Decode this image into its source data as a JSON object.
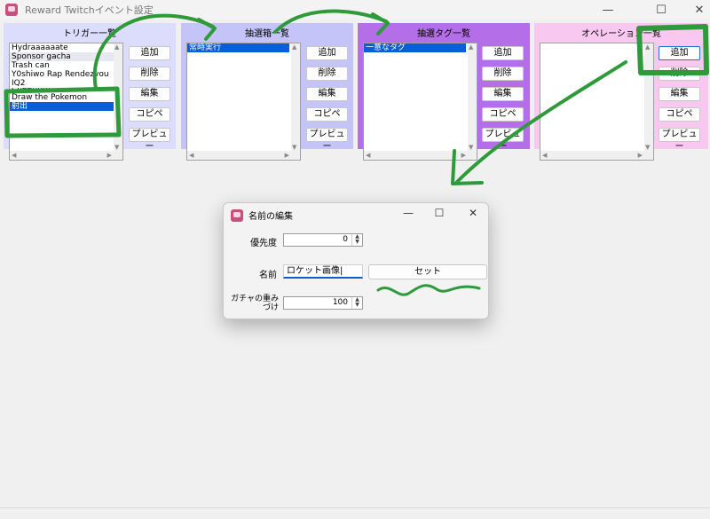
{
  "window": {
    "title": "Reward Twitchイベント設定",
    "minimize_glyph": "—",
    "maximize_glyph": "☐",
    "close_glyph": "✕"
  },
  "panels": [
    {
      "title": "トリガー一覧",
      "bg": "#dcdcfc",
      "items": [
        {
          "text": "Hydraaaaaate",
          "selected": false
        },
        {
          "text": "Sponsor gacha",
          "selected": false
        },
        {
          "text": "Trash can",
          "selected": false
        },
        {
          "text": "Y0shiwo Rap Rendezvou",
          "selected": false
        },
        {
          "text": "IQ2",
          "selected": false
        },
        {
          "text": "Cheering!",
          "selected": false
        },
        {
          "text": "Draw the Pokemon",
          "selected": false
        },
        {
          "text": "射出",
          "selected": true
        }
      ],
      "buttons": [
        "追加",
        "削除",
        "編集",
        "コピペ",
        "プレビュー"
      ]
    },
    {
      "title": "抽選箱一覧",
      "bg": "#c4c4f8",
      "items": [
        {
          "text": "常時実行",
          "selected": true
        }
      ],
      "buttons": [
        "追加",
        "削除",
        "編集",
        "コピペ",
        "プレビュー"
      ]
    },
    {
      "title": "抽選タグ一覧",
      "bg": "#b46ee8",
      "items": [
        {
          "text": "一意なタグ",
          "selected": true
        }
      ],
      "buttons": [
        "追加",
        "削除",
        "編集",
        "コピペ",
        "プレビュー"
      ]
    },
    {
      "title": "オペレーション一覧",
      "bg": "#f8c8f0",
      "items": [],
      "buttons": [
        "追加",
        "削除",
        "編集",
        "コピペ",
        "プレビュー"
      ]
    }
  ],
  "dialog": {
    "title": "名前の編集",
    "priority_label": "優先度",
    "priority_value": "0",
    "name_label": "名前",
    "name_value": "ロケット画像|",
    "set_label": "セット",
    "weight_label_line1": "ガチャの重み",
    "weight_label_line2": "づけ",
    "weight_value": "100"
  },
  "colors": {
    "annotation_green": "#2e9a3a",
    "selection_blue": "#0a5fd8",
    "focus_blue": "#2a6fd6"
  },
  "icons": {
    "app": "reward-app-icon",
    "scroll_up": "▲",
    "scroll_down": "▼",
    "scroll_left": "◀",
    "scroll_right": "▶",
    "spin_up": "▲",
    "spin_down": "▼"
  }
}
